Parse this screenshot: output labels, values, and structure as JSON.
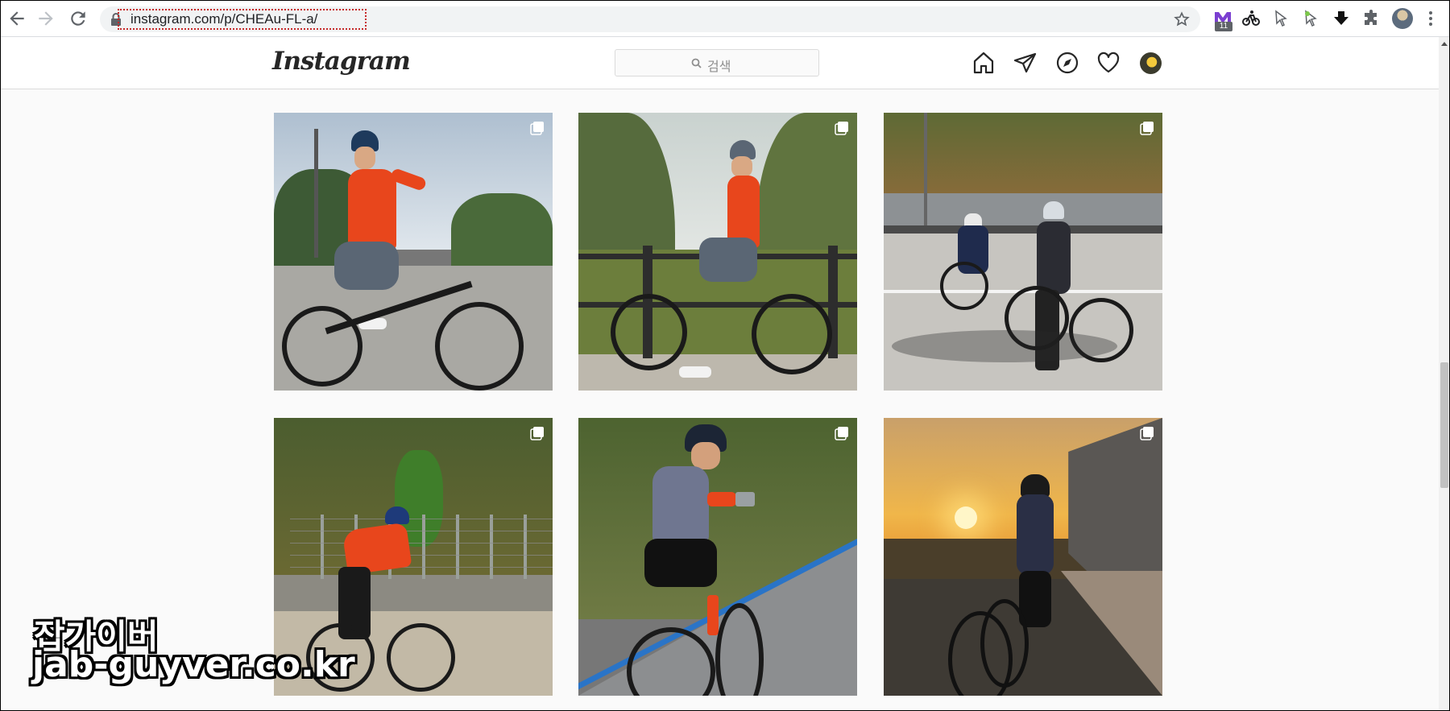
{
  "browser": {
    "url": "instagram.com/p/CHEAu-FL-a/",
    "extension_badge": "11",
    "icons": [
      "back-icon",
      "forward-icon",
      "reload-icon",
      "lock-icon",
      "star-icon",
      "extension-m-icon",
      "extension-bike-icon",
      "extension-cursor-icon",
      "extension-leaf-cursor-icon",
      "extension-download-icon",
      "puzzle-icon",
      "kebab-menu-icon"
    ]
  },
  "instagram": {
    "logo": "Instagram",
    "search_placeholder": "검색",
    "nav_icons": [
      "home-icon",
      "direct-icon",
      "explore-icon",
      "heart-icon",
      "profile-avatar"
    ]
  },
  "grid": {
    "photos": [
      {
        "id": 1,
        "scene": "orange jersey rider with bike, street",
        "multi": true
      },
      {
        "id": 2,
        "scene": "rider leaning on fence, trees",
        "multi": true
      },
      {
        "id": 3,
        "scene": "two riders on road",
        "multi": true
      },
      {
        "id": 4,
        "scene": "rider with fence, orange jersey",
        "multi": true
      },
      {
        "id": 5,
        "scene": "rider taking photo on road",
        "multi": true
      },
      {
        "id": 6,
        "scene": "rider at sunset",
        "multi": true
      }
    ]
  },
  "watermark": {
    "line1": "잡가이버",
    "line2": "jab-guyver.co.kr"
  },
  "colors": {
    "jersey_orange": "#e8461c",
    "ig_text": "#262626",
    "url_box_red": "#c62828"
  }
}
